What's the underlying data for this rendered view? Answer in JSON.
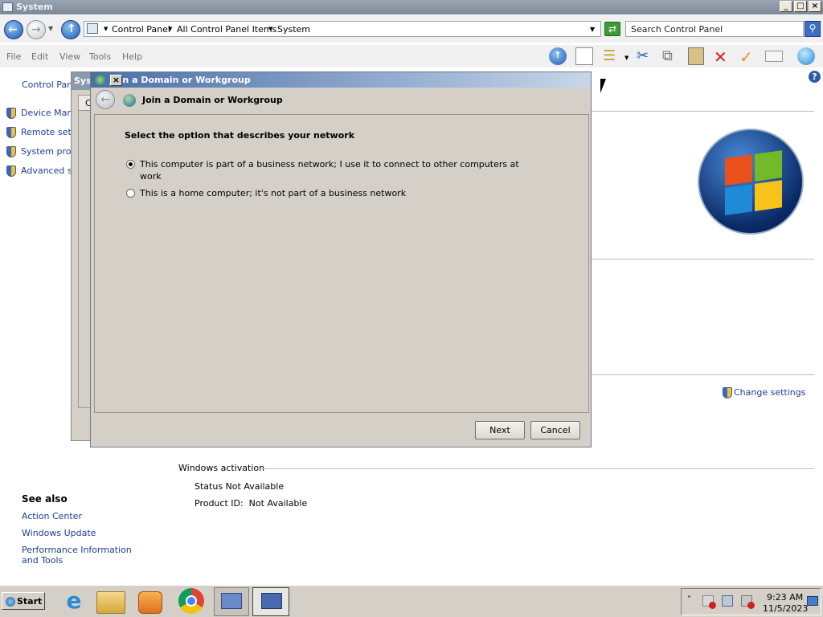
{
  "window": {
    "title": "System"
  },
  "address": {
    "crumbs": [
      "Control Panel",
      "All Control Panel Items",
      "System"
    ],
    "search_placeholder": "Search Control Panel"
  },
  "menu": [
    "File",
    "Edit",
    "View",
    "Tools",
    "Help"
  ],
  "sidebar": {
    "home": "Control Pane",
    "items": [
      "Device Mana",
      "Remote setti",
      "System prote",
      "Advanced sy"
    ]
  },
  "background_window": {
    "title_fragment": "Sys",
    "tab_fragment": "C"
  },
  "change_settings": "Change settings",
  "see_also": {
    "heading": "See also",
    "links": [
      "Action Center",
      "Windows Update",
      "Performance Information and Tools"
    ]
  },
  "activation": {
    "heading": "Windows activation",
    "status": "Status Not Available",
    "product_id": "Product ID:  Not Available"
  },
  "dialog": {
    "title": "Join a Domain or Workgroup",
    "header": "Join a Domain or Workgroup",
    "prompt": "Select the option that describes your network",
    "options": [
      {
        "label_line1": "This computer is part of a business network; I use it to connect to other computers at",
        "label_line2": "work",
        "selected": true
      },
      {
        "label_line1": "This is a home computer; it's not part of a business network",
        "selected": false
      }
    ],
    "next": "Next",
    "cancel": "Cancel"
  },
  "taskbar": {
    "start": "Start",
    "time": "9:23 AM",
    "date": "11/5/2023"
  }
}
